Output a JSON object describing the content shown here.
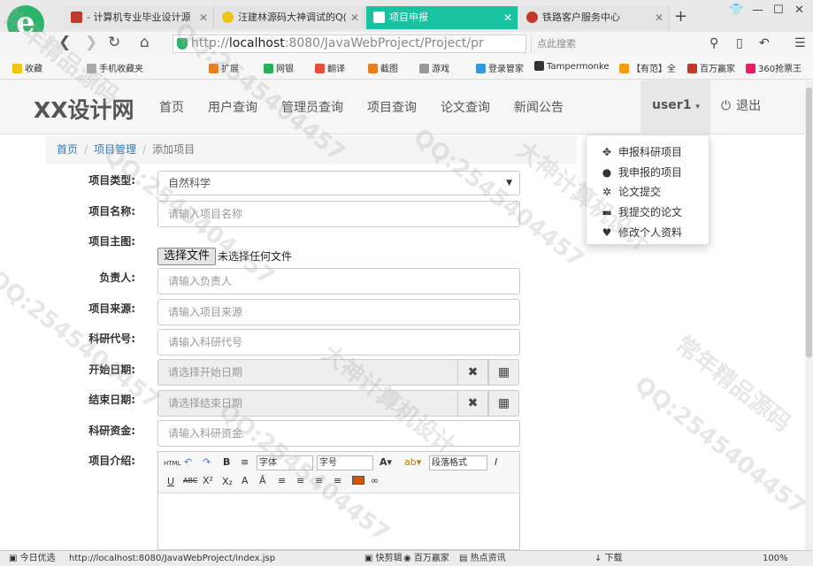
{
  "browser": {
    "tabs": [
      {
        "title": "- 计算机专业毕业设计源"
      },
      {
        "title": "汪建林源码大神调试的Q("
      },
      {
        "title": "项目申报"
      },
      {
        "title": "铁路客户服务中心"
      }
    ],
    "address": {
      "scheme": "http://",
      "host": "localhost",
      "path": ":8080/JavaWebProject/Project/pr"
    },
    "search_placeholder": "点此搜索",
    "bookmarks": [
      "收藏",
      "手机收藏夹",
      "扩展",
      "网银",
      "翻译",
      "截图",
      "游戏",
      "登录管家",
      "Tampermonke",
      "【有范】全",
      "百万赢家",
      "360抢票王"
    ]
  },
  "site": {
    "brand": "XX设计网",
    "nav": [
      "首页",
      "用户查询",
      "管理员查询",
      "项目查询",
      "论文查询",
      "新闻公告"
    ],
    "user": "user1",
    "logout": "退出",
    "dropdown": [
      "申报科研项目",
      "我申报的项目",
      "论文提交",
      "我提交的论文",
      "修改个人资料"
    ]
  },
  "breadcrumb": {
    "home": "首页",
    "section": "项目管理",
    "current": "添加项目"
  },
  "form": {
    "type_label": "项目类型:",
    "type_value": "自然科学",
    "name_label": "项目名称:",
    "name_placeholder": "请输入项目名称",
    "image_label": "项目主图:",
    "file_button": "选择文件",
    "file_status": "未选择任何文件",
    "leader_label": "负责人:",
    "leader_placeholder": "请输入负责人",
    "source_label": "项目来源:",
    "source_placeholder": "请输入项目来源",
    "code_label": "科研代号:",
    "code_placeholder": "请输入科研代号",
    "start_label": "开始日期:",
    "start_placeholder": "请选择开始日期",
    "end_label": "结束日期:",
    "end_placeholder": "请选择结束日期",
    "fund_label": "科研资金:",
    "fund_placeholder": "请输入科研资金",
    "intro_label": "项目介绍:"
  },
  "editor": {
    "font_family": "字体",
    "font_size": "字号",
    "paragraph": "段落格式",
    "html_btn": "HTML"
  },
  "status": {
    "left": "今日优选",
    "url": "http://localhost:8080/JavaWebProject/index.jsp",
    "items": [
      "快剪辑",
      "百万赢家",
      "热点资讯",
      "下载"
    ],
    "zoom": "100%"
  },
  "watermarks": [
    "大神计算机设计",
    "QQ:2545404457",
    "常年精品源码"
  ],
  "colors": {
    "active_tab": "#19c3a1",
    "link": "#337ab7",
    "brand": "#555555"
  }
}
